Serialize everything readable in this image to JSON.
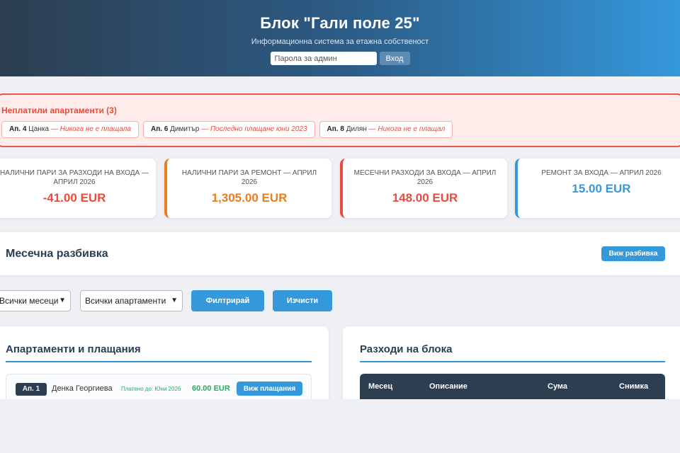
{
  "header": {
    "title": "Блок \"Гали поле 25\"",
    "subtitle": "Информационна система за етажна собственост",
    "password_placeholder": "Парола за админ",
    "login_label": "Вход"
  },
  "unpaid": {
    "title": "Неплатили апартаменти (3)",
    "items": [
      {
        "apt": "Ап. 4",
        "name": "Цанка",
        "sep": "—",
        "note": "Никога не е плащала"
      },
      {
        "apt": "Ап. 6",
        "name": "Димитър",
        "sep": "—",
        "note": "Последно плащане юни 2023"
      },
      {
        "apt": "Ап. 8",
        "name": "Дилян",
        "sep": "—",
        "note": "Никога не е плащал"
      }
    ]
  },
  "cards": [
    {
      "label": "Налични пари за разходи на входа — Април 2026",
      "value": "-41.00 EUR",
      "color": "#e74c3c"
    },
    {
      "label": "Налични пари за ремонт — Април 2026",
      "value": "1,305.00 EUR",
      "color": "#e67e22"
    },
    {
      "label": "Месечни разходи за входа — Април 2026",
      "value": "148.00 EUR",
      "color": "#e74c3c"
    },
    {
      "label": "Ремонт за входа — Април 2026",
      "value": "15.00 EUR",
      "color": "#3498db"
    }
  ],
  "breakdown": {
    "title": "Месечна разбивка",
    "button": "Виж разбивка"
  },
  "filters": {
    "month_select": "Всички месеци",
    "apartment_select": "Всички апартаменти",
    "filter_button": "Филтрирай",
    "clear_button": "Изчисти"
  },
  "apartments": {
    "title": "Апартаменти и плащания",
    "rows": [
      {
        "apt": "Ап. 1",
        "name": "Денка Георгиева",
        "paid_until": "Платено до: Юни 2026",
        "amount": "60.00 EUR",
        "button": "Виж плащания"
      }
    ]
  },
  "expenses": {
    "title": "Разходи на блока",
    "columns": [
      "Месец",
      "Описание",
      "Сума",
      "Снимка"
    ]
  },
  "colors": {
    "accent": "#3498db",
    "dark": "#2c3e50",
    "danger": "#e74c3c",
    "warning": "#e67e22",
    "success": "#27ae60"
  }
}
